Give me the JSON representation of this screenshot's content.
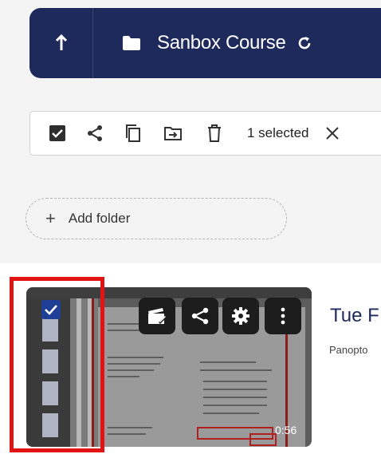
{
  "header": {
    "title": "Sanbox Course"
  },
  "toolbar": {
    "selected_label": "1 selected"
  },
  "add_folder": {
    "label": "Add folder",
    "plus": "+"
  },
  "session": {
    "title": "Tue F",
    "subtitle": "Panopto",
    "duration": "0:56"
  },
  "colors": {
    "header_bg": "#1f2a5c",
    "highlight_border": "#e11313",
    "thumb_check_bg": "#1f3f96"
  }
}
